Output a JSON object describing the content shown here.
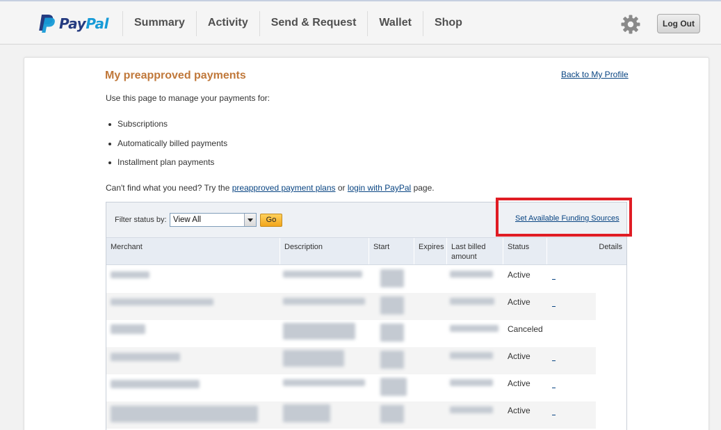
{
  "header": {
    "logo_part1": "Pay",
    "logo_part2": "Pal",
    "nav": [
      "Summary",
      "Activity",
      "Send & Request",
      "Wallet",
      "Shop"
    ],
    "settings_icon": "gear-icon",
    "logout_label": "Log Out"
  },
  "page": {
    "title": "My preapproved payments",
    "back_link": "Back to My Profile",
    "intro": "Use this page to manage your payments for:",
    "bullets": [
      "Subscriptions",
      "Automatically billed payments",
      "Installment plan payments"
    ],
    "cantfind_prefix": "Can't find what you need? Try the ",
    "cantfind_link1": "preapproved payment plans",
    "cantfind_or": " or ",
    "cantfind_link2": "login with PayPal",
    "cantfind_suffix": " page."
  },
  "filter": {
    "label": "Filter status by:",
    "selected": "View All",
    "go_label": "Go",
    "funding_link": "Set Available Funding Sources"
  },
  "table": {
    "columns": [
      "Merchant",
      "Description",
      "Start",
      "Expires",
      "Last billed amount",
      "Status",
      "Details"
    ],
    "rows": [
      {
        "status": "Active",
        "has_detail": true
      },
      {
        "status": "Active",
        "has_detail": true
      },
      {
        "status": "Canceled",
        "has_detail": false
      },
      {
        "status": "Active",
        "has_detail": true
      },
      {
        "status": "Active",
        "has_detail": true
      },
      {
        "status": "Active",
        "has_detail": true
      }
    ]
  },
  "colors": {
    "title": "#c0783a",
    "link": "#084482",
    "highlight_box": "#e01c24",
    "logo_dark": "#253b80",
    "logo_light": "#179bd7"
  }
}
